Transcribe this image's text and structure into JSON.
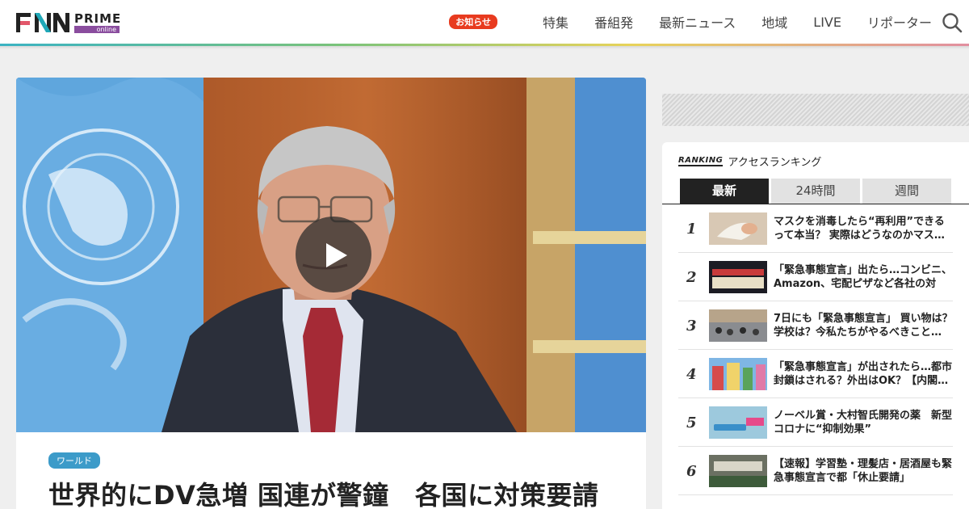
{
  "header": {
    "logo": {
      "name": "PRIME",
      "sub": "online"
    },
    "notice_badge": "お知らせ",
    "nav": [
      "特集",
      "番組発",
      "最新ニュース",
      "地域",
      "LIVE",
      "リポーター"
    ]
  },
  "article": {
    "category": "ワールド",
    "title": "世界的にDV急増 国連が警鐘　各国に対策要請"
  },
  "ranking": {
    "logo": "RANKING",
    "title": "アクセスランキング",
    "tabs": [
      "最新",
      "24時間",
      "週間"
    ],
    "active_tab": "最新",
    "items": [
      {
        "rank": "1",
        "text": "マスクを消毒したら“再利用”できるって本当？ 実際はどうなのかマス…"
      },
      {
        "rank": "2",
        "text": "「緊急事態宣言」出たら…コンビニ、Amazon、宅配ピザなど各社の対応…"
      },
      {
        "rank": "3",
        "text": "7日にも「緊急事態宣言」 買い物は？学校は？今私たちがやるべきこと…"
      },
      {
        "rank": "4",
        "text": "「緊急事態宣言」が出されたら…都市封鎖はされる？外出はOK？【内閣…"
      },
      {
        "rank": "5",
        "text": "ノーベル賞・大村智氏開発の薬　新型コロナに“抑制効果”"
      },
      {
        "rank": "6",
        "text": "【速報】学習塾・理髪店・居酒屋も緊急事態宣言で都「休止要請」"
      }
    ]
  },
  "colors": {
    "brand_purple": "#8a4d9e",
    "notice_red": "#e83b1f",
    "category_blue": "#3c9bc9"
  }
}
